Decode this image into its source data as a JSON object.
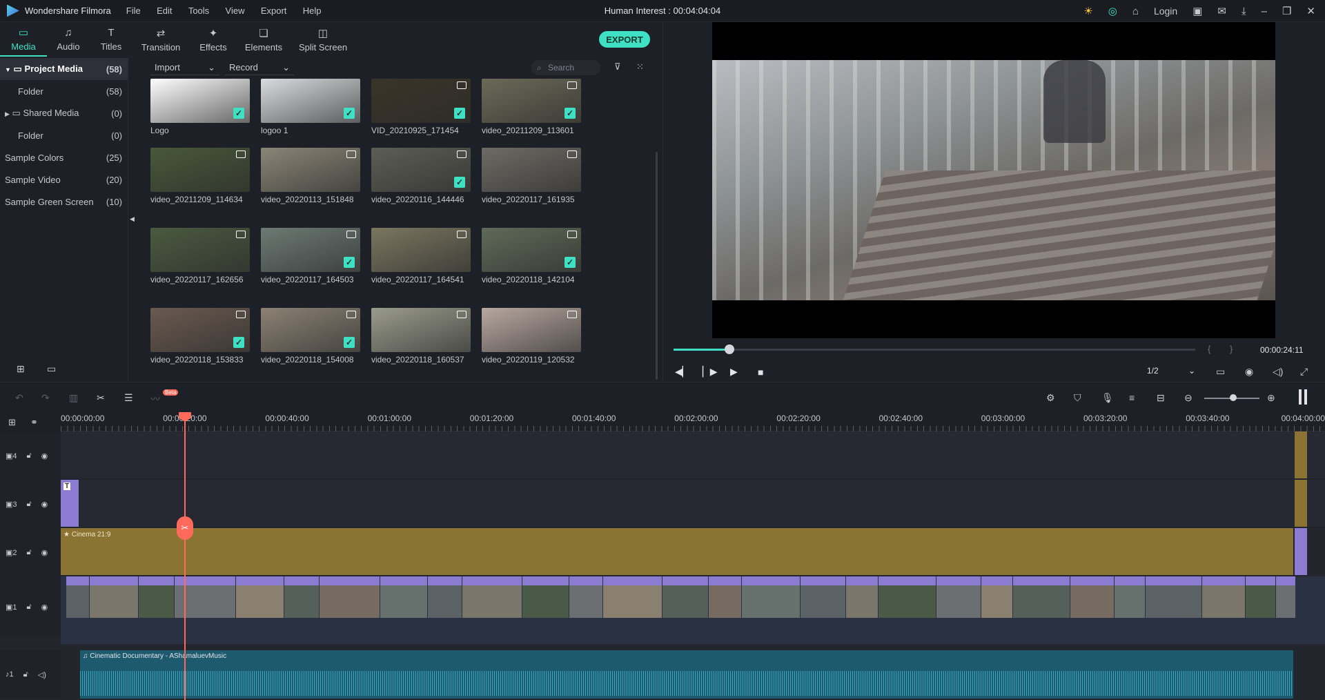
{
  "app": {
    "name": "Wondershare Filmora",
    "project_title": "Human Interest : 00:04:04:04",
    "login": "Login"
  },
  "menu": [
    "File",
    "Edit",
    "Tools",
    "View",
    "Export",
    "Help"
  ],
  "tabs": [
    {
      "label": "Media",
      "icon": "folder-icon"
    },
    {
      "label": "Audio",
      "icon": "music-note-icon"
    },
    {
      "label": "Titles",
      "icon": "text-icon"
    },
    {
      "label": "Transition",
      "icon": "transition-icon"
    },
    {
      "label": "Effects",
      "icon": "effects-icon"
    },
    {
      "label": "Elements",
      "icon": "elements-icon"
    },
    {
      "label": "Split Screen",
      "icon": "split-screen-icon"
    }
  ],
  "export_label": "EXPORT",
  "sidebar": [
    {
      "label": "Project Media",
      "count": "(58)"
    },
    {
      "label": "Folder",
      "count": "(58)"
    },
    {
      "label": "Shared Media",
      "count": "(0)"
    },
    {
      "label": "Folder",
      "count": "(0)"
    },
    {
      "label": "Sample Colors",
      "count": "(25)"
    },
    {
      "label": "Sample Video",
      "count": "(20)"
    },
    {
      "label": "Sample Green Screen",
      "count": "(10)"
    }
  ],
  "media_bar": {
    "import": "Import",
    "record": "Record",
    "search_placeholder": "Search"
  },
  "media": [
    {
      "name": "Logo",
      "checked": true,
      "color": "#ffffff"
    },
    {
      "name": "logoo 1",
      "checked": true,
      "color": "#d9dcdf"
    },
    {
      "name": "VID_20210925_171454",
      "checked": true,
      "color": "#3a3428"
    },
    {
      "name": "video_20211209_113601",
      "checked": true,
      "color": "#6b6a58"
    },
    {
      "name": "video_20211209_114634",
      "checked": false,
      "color": "#48583a"
    },
    {
      "name": "video_20220113_151848",
      "checked": false,
      "color": "#8a8576"
    },
    {
      "name": "video_20220116_144446",
      "checked": true,
      "color": "#5c5e54"
    },
    {
      "name": "video_20220117_161935",
      "checked": false,
      "color": "#6c6b64"
    },
    {
      "name": "video_20220117_162656",
      "checked": false,
      "color": "#4a5a40"
    },
    {
      "name": "video_20220117_164503",
      "checked": true,
      "color": "#6d7a74"
    },
    {
      "name": "video_20220117_164541",
      "checked": false,
      "color": "#7a7660"
    },
    {
      "name": "video_20220118_142104",
      "checked": true,
      "color": "#5f6a58"
    },
    {
      "name": "video_20220118_153833",
      "checked": true,
      "color": "#6a5a50"
    },
    {
      "name": "video_20220118_154008",
      "checked": true,
      "color": "#8c8274"
    },
    {
      "name": "video_20220118_160537",
      "checked": false,
      "color": "#9a9c8c"
    },
    {
      "name": "video_20220119_120532",
      "checked": false,
      "color": "#b8a8a0"
    }
  ],
  "player": {
    "time": "00:00:24:11",
    "progress": 0.09,
    "page": "1/2"
  },
  "toolbar_badge": "Beta",
  "ruler": [
    "00:00:00:00",
    "00:00:20:00",
    "00:00:40:00",
    "00:01:00:00",
    "00:01:20:00",
    "00:01:40:00",
    "00:02:00:00",
    "00:02:20:00",
    "00:02:40:00",
    "00:03:00:00",
    "00:03:20:00",
    "00:03:40:00",
    "00:04:00:00"
  ],
  "tracks": {
    "t4": "4",
    "t3": "3",
    "t2": "2",
    "t1": "1",
    "a1": "1"
  },
  "clips": {
    "effect_label": "Cinema 21:9",
    "audio_label": "Cinematic Documentary - AShamaluevMusic"
  }
}
